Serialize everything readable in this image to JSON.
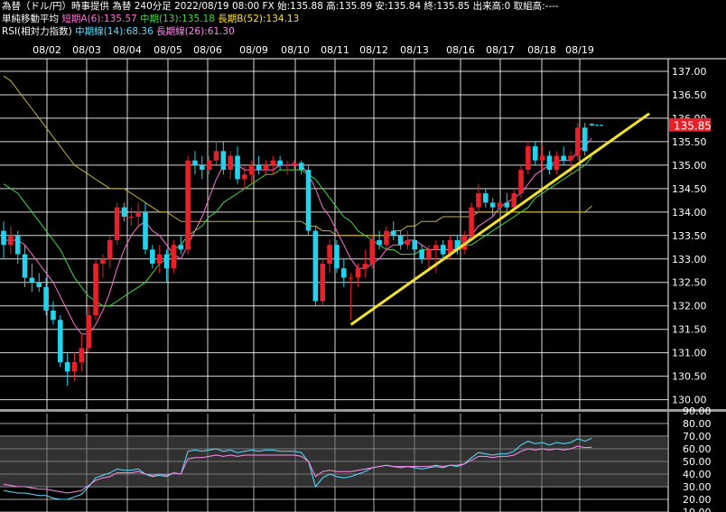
{
  "header": {
    "line1": "為替（ドル/円）時事提供 為替 240分足 2022/08/19 08:00 FX 始:135.88 高:135.89 安:135.84 終:135.85 出来高:0 取組高:----",
    "ma_title": "単純移動平均",
    "ma_short": "短期A(6):135.57",
    "ma_mid": "中期(13):135.18",
    "ma_long": "長期B(52):134.13",
    "rsi_title": "RSI(相対力指数)",
    "rsi_mid": "中期線(14):68.36",
    "rsi_long": "長期線(26):61.30"
  },
  "colors": {
    "background": "#000000",
    "grid": "#ffffff",
    "up_candle": "#e8202a",
    "down_candle": "#22d3ee",
    "ma_short": "#ff6fd8",
    "ma_mid": "#3ddc3d",
    "ma_long": "#c8b040",
    "trendline": "#f0e030",
    "rsi_mid": "#58e0ff",
    "rsi_long": "#ff8cf0",
    "price_tag": "#e8202a",
    "rsi_band": "#5a5a5a"
  },
  "chart_data": [
    {
      "type": "candlestick",
      "timeframe": "240min",
      "categories": [
        "08/02",
        "08/03",
        "08/04",
        "08/05",
        "08/06",
        "08/09",
        "08/10",
        "08/11",
        "08/12",
        "08/13",
        "08/16",
        "08/17",
        "08/18",
        "08/19"
      ],
      "ylim": [
        129.8,
        137.25
      ],
      "yticks": [
        130.0,
        130.5,
        131.0,
        131.5,
        132.0,
        132.5,
        133.0,
        133.5,
        134.0,
        134.5,
        135.0,
        135.5,
        136.0,
        136.5,
        137.0
      ],
      "last_price": "135.85",
      "candles": [
        {
          "o": 133.6,
          "h": 133.8,
          "l": 133.0,
          "c": 133.3
        },
        {
          "o": 133.3,
          "h": 133.7,
          "l": 133.1,
          "c": 133.5
        },
        {
          "o": 133.5,
          "h": 133.6,
          "l": 132.9,
          "c": 133.1
        },
        {
          "o": 133.1,
          "h": 133.3,
          "l": 132.4,
          "c": 132.6
        },
        {
          "o": 132.6,
          "h": 132.9,
          "l": 132.3,
          "c": 132.5
        },
        {
          "o": 132.5,
          "h": 132.7,
          "l": 132.3,
          "c": 132.4
        },
        {
          "o": 132.4,
          "h": 132.6,
          "l": 131.8,
          "c": 131.9
        },
        {
          "o": 131.9,
          "h": 132.1,
          "l": 131.6,
          "c": 131.7
        },
        {
          "o": 131.7,
          "h": 131.8,
          "l": 130.7,
          "c": 130.8
        },
        {
          "o": 130.8,
          "h": 131.0,
          "l": 130.3,
          "c": 130.6
        },
        {
          "o": 130.6,
          "h": 131.0,
          "l": 130.4,
          "c": 130.8
        },
        {
          "o": 130.8,
          "h": 131.4,
          "l": 130.6,
          "c": 131.1
        },
        {
          "o": 131.1,
          "h": 132.0,
          "l": 131.0,
          "c": 131.8
        },
        {
          "o": 131.8,
          "h": 133.0,
          "l": 131.7,
          "c": 132.9
        },
        {
          "o": 132.9,
          "h": 133.1,
          "l": 132.6,
          "c": 133.0
        },
        {
          "o": 133.0,
          "h": 133.5,
          "l": 132.8,
          "c": 133.4
        },
        {
          "o": 133.4,
          "h": 134.2,
          "l": 133.3,
          "c": 134.1
        },
        {
          "o": 134.1,
          "h": 134.2,
          "l": 133.8,
          "c": 133.9
        },
        {
          "o": 133.9,
          "h": 134.1,
          "l": 133.7,
          "c": 133.9
        },
        {
          "o": 133.9,
          "h": 134.2,
          "l": 133.7,
          "c": 134.0
        },
        {
          "o": 134.0,
          "h": 134.2,
          "l": 133.1,
          "c": 133.2
        },
        {
          "o": 133.2,
          "h": 133.3,
          "l": 132.8,
          "c": 132.9
        },
        {
          "o": 132.9,
          "h": 133.3,
          "l": 132.7,
          "c": 133.1
        },
        {
          "o": 133.1,
          "h": 133.2,
          "l": 132.5,
          "c": 132.8
        },
        {
          "o": 132.8,
          "h": 133.4,
          "l": 132.7,
          "c": 133.3
        },
        {
          "o": 133.3,
          "h": 133.5,
          "l": 133.1,
          "c": 133.2
        },
        {
          "o": 133.2,
          "h": 135.2,
          "l": 133.1,
          "c": 135.1
        },
        {
          "o": 135.1,
          "h": 135.3,
          "l": 134.8,
          "c": 135.0
        },
        {
          "o": 135.0,
          "h": 135.2,
          "l": 134.7,
          "c": 134.9
        },
        {
          "o": 134.9,
          "h": 135.2,
          "l": 134.8,
          "c": 135.1
        },
        {
          "o": 135.1,
          "h": 135.5,
          "l": 135.0,
          "c": 135.3
        },
        {
          "o": 135.3,
          "h": 135.5,
          "l": 134.8,
          "c": 134.9
        },
        {
          "o": 134.9,
          "h": 135.3,
          "l": 134.7,
          "c": 135.2
        },
        {
          "o": 135.2,
          "h": 135.4,
          "l": 134.6,
          "c": 134.7
        },
        {
          "o": 134.7,
          "h": 135.0,
          "l": 134.5,
          "c": 134.8
        },
        {
          "o": 134.8,
          "h": 135.1,
          "l": 134.6,
          "c": 135.0
        },
        {
          "o": 135.0,
          "h": 135.2,
          "l": 134.8,
          "c": 134.9
        },
        {
          "o": 134.9,
          "h": 135.1,
          "l": 134.8,
          "c": 135.0
        },
        {
          "o": 135.0,
          "h": 135.2,
          "l": 134.8,
          "c": 135.1
        },
        {
          "o": 135.1,
          "h": 135.2,
          "l": 134.9,
          "c": 135.0
        },
        {
          "o": 135.0,
          "h": 135.1,
          "l": 134.8,
          "c": 135.0
        },
        {
          "o": 135.0,
          "h": 135.1,
          "l": 134.9,
          "c": 135.05
        },
        {
          "o": 135.05,
          "h": 135.1,
          "l": 134.8,
          "c": 134.9
        },
        {
          "o": 134.9,
          "h": 135.0,
          "l": 133.5,
          "c": 133.6
        },
        {
          "o": 133.6,
          "h": 133.7,
          "l": 132.0,
          "c": 132.1
        },
        {
          "o": 132.1,
          "h": 133.0,
          "l": 132.0,
          "c": 132.9
        },
        {
          "o": 132.9,
          "h": 133.4,
          "l": 132.7,
          "c": 133.3
        },
        {
          "o": 133.3,
          "h": 133.4,
          "l": 132.7,
          "c": 132.8
        },
        {
          "o": 132.8,
          "h": 133.0,
          "l": 132.4,
          "c": 132.6
        },
        {
          "o": 132.6,
          "h": 132.7,
          "l": 131.7,
          "c": 132.6
        },
        {
          "o": 132.6,
          "h": 132.9,
          "l": 132.4,
          "c": 132.8
        },
        {
          "o": 132.8,
          "h": 133.2,
          "l": 132.6,
          "c": 132.9
        },
        {
          "o": 132.9,
          "h": 133.5,
          "l": 132.8,
          "c": 133.4
        },
        {
          "o": 133.4,
          "h": 133.6,
          "l": 133.2,
          "c": 133.3
        },
        {
          "o": 133.3,
          "h": 133.7,
          "l": 133.2,
          "c": 133.6
        },
        {
          "o": 133.6,
          "h": 133.8,
          "l": 133.4,
          "c": 133.5
        },
        {
          "o": 133.5,
          "h": 133.6,
          "l": 133.2,
          "c": 133.3
        },
        {
          "o": 133.3,
          "h": 133.6,
          "l": 133.2,
          "c": 133.4
        },
        {
          "o": 133.4,
          "h": 133.5,
          "l": 133.1,
          "c": 133.2
        },
        {
          "o": 133.2,
          "h": 133.3,
          "l": 132.9,
          "c": 133.0
        },
        {
          "o": 133.0,
          "h": 133.3,
          "l": 132.8,
          "c": 133.2
        },
        {
          "o": 133.2,
          "h": 133.4,
          "l": 132.7,
          "c": 133.3
        },
        {
          "o": 133.3,
          "h": 133.4,
          "l": 133.0,
          "c": 133.1
        },
        {
          "o": 133.1,
          "h": 133.5,
          "l": 133.0,
          "c": 133.4
        },
        {
          "o": 133.4,
          "h": 133.5,
          "l": 133.1,
          "c": 133.2
        },
        {
          "o": 133.2,
          "h": 133.6,
          "l": 133.1,
          "c": 133.5
        },
        {
          "o": 133.5,
          "h": 134.2,
          "l": 133.4,
          "c": 134.1
        },
        {
          "o": 134.1,
          "h": 134.6,
          "l": 134.0,
          "c": 134.4
        },
        {
          "o": 134.4,
          "h": 134.5,
          "l": 134.1,
          "c": 134.2
        },
        {
          "o": 134.2,
          "h": 134.3,
          "l": 133.9,
          "c": 134.1
        },
        {
          "o": 134.1,
          "h": 134.3,
          "l": 133.9,
          "c": 134.2
        },
        {
          "o": 134.2,
          "h": 134.4,
          "l": 134.0,
          "c": 134.1
        },
        {
          "o": 134.1,
          "h": 134.5,
          "l": 134.0,
          "c": 134.4
        },
        {
          "o": 134.4,
          "h": 135.0,
          "l": 134.3,
          "c": 134.9
        },
        {
          "o": 134.9,
          "h": 135.5,
          "l": 134.8,
          "c": 135.4
        },
        {
          "o": 135.4,
          "h": 135.5,
          "l": 135.0,
          "c": 135.1
        },
        {
          "o": 135.1,
          "h": 135.4,
          "l": 134.9,
          "c": 135.2
        },
        {
          "o": 135.2,
          "h": 135.3,
          "l": 134.8,
          "c": 134.9
        },
        {
          "o": 134.9,
          "h": 135.3,
          "l": 134.8,
          "c": 135.2
        },
        {
          "o": 135.2,
          "h": 135.4,
          "l": 135.0,
          "c": 135.1
        },
        {
          "o": 135.1,
          "h": 135.3,
          "l": 134.8,
          "c": 135.2
        },
        {
          "o": 135.2,
          "h": 135.9,
          "l": 135.1,
          "c": 135.8
        },
        {
          "o": 135.8,
          "h": 135.9,
          "l": 135.2,
          "c": 135.3
        },
        {
          "o": 135.88,
          "h": 135.89,
          "l": 135.84,
          "c": 135.85
        }
      ],
      "ma_short": [
        133.4,
        133.4,
        133.4,
        133.3,
        133.1,
        132.9,
        132.7,
        132.5,
        132.2,
        131.9,
        131.6,
        131.4,
        131.4,
        131.6,
        131.9,
        132.3,
        132.8,
        133.2,
        133.5,
        133.7,
        133.8,
        133.6,
        133.5,
        133.3,
        133.1,
        133.0,
        133.3,
        133.6,
        133.9,
        134.3,
        134.7,
        135.0,
        135.0,
        135.0,
        134.9,
        134.9,
        134.9,
        134.9,
        134.9,
        135.0,
        135.0,
        135.0,
        135.0,
        134.8,
        134.5,
        134.1,
        133.9,
        133.6,
        133.3,
        133.0,
        132.8,
        132.8,
        132.9,
        133.0,
        133.2,
        133.3,
        133.3,
        133.4,
        133.4,
        133.3,
        133.2,
        133.2,
        133.2,
        133.2,
        133.2,
        133.3,
        133.5,
        133.7,
        133.8,
        133.9,
        134.1,
        134.2,
        134.3,
        134.4,
        134.6,
        134.8,
        134.9,
        135.0,
        135.1,
        135.1,
        135.1,
        135.3,
        135.4,
        135.57
      ],
      "ma_mid": [
        134.6,
        134.5,
        134.4,
        134.2,
        134.0,
        133.8,
        133.6,
        133.4,
        133.2,
        132.9,
        132.6,
        132.4,
        132.2,
        132.1,
        132.0,
        132.0,
        132.1,
        132.2,
        132.3,
        132.4,
        132.5,
        132.7,
        132.9,
        133.0,
        133.2,
        133.3,
        133.5,
        133.6,
        133.7,
        133.9,
        134.0,
        134.2,
        134.3,
        134.4,
        134.5,
        134.6,
        134.7,
        134.8,
        134.8,
        134.9,
        134.9,
        134.9,
        134.9,
        134.8,
        134.7,
        134.5,
        134.3,
        134.1,
        133.9,
        133.8,
        133.6,
        133.5,
        133.4,
        133.3,
        133.2,
        133.2,
        133.1,
        133.1,
        133.1,
        133.2,
        133.2,
        133.2,
        133.2,
        133.2,
        133.2,
        133.3,
        133.3,
        133.4,
        133.5,
        133.6,
        133.7,
        133.8,
        133.9,
        134.0,
        134.1,
        134.3,
        134.4,
        134.5,
        134.6,
        134.7,
        134.8,
        134.9,
        135.0,
        135.18
      ],
      "ma_long": [
        136.9,
        136.8,
        136.6,
        136.4,
        136.2,
        136.0,
        135.8,
        135.6,
        135.4,
        135.2,
        135.0,
        134.9,
        134.8,
        134.7,
        134.6,
        134.5,
        134.5,
        134.5,
        134.4,
        134.3,
        134.2,
        134.1,
        134.0,
        134.0,
        133.9,
        133.8,
        133.8,
        133.8,
        133.8,
        133.8,
        133.8,
        133.8,
        133.8,
        133.8,
        133.8,
        133.8,
        133.8,
        133.8,
        133.8,
        133.8,
        133.8,
        133.8,
        133.8,
        133.7,
        133.7,
        133.6,
        133.6,
        133.5,
        133.5,
        133.5,
        133.5,
        133.5,
        133.5,
        133.5,
        133.5,
        133.6,
        133.6,
        133.7,
        133.7,
        133.8,
        133.8,
        133.8,
        133.9,
        133.9,
        133.9,
        133.9,
        133.9,
        134.0,
        134.0,
        134.0,
        134.0,
        134.0,
        134.0,
        134.0,
        134.0,
        134.0,
        134.0,
        134.0,
        134.0,
        134.0,
        134.0,
        134.0,
        134.0,
        134.13
      ],
      "trendline": {
        "from": {
          "index": 49,
          "price": 131.6
        },
        "to": {
          "index": 86,
          "price": 135.6
        }
      }
    },
    {
      "type": "line",
      "name": "RSI",
      "ylim": [
        10,
        90
      ],
      "yticks": [
        10,
        20,
        30,
        40,
        50,
        60,
        70,
        80,
        90
      ],
      "shaded_band": [
        30,
        70
      ],
      "series": [
        {
          "name": "中期線(14)",
          "color": "#58e0ff",
          "values": [
            27,
            26,
            25,
            25,
            24,
            23,
            23,
            21,
            20,
            20,
            22,
            24,
            30,
            37,
            39,
            41,
            44,
            43,
            43,
            44,
            40,
            38,
            39,
            38,
            41,
            40,
            58,
            59,
            58,
            59,
            60,
            58,
            59,
            57,
            58,
            59,
            58,
            59,
            59,
            58,
            58,
            58,
            57,
            50,
            30,
            37,
            40,
            38,
            37,
            38,
            40,
            42,
            45,
            46,
            47,
            46,
            45,
            46,
            45,
            44,
            45,
            46,
            45,
            47,
            46,
            48,
            53,
            57,
            56,
            55,
            56,
            56,
            58,
            63,
            66,
            64,
            65,
            63,
            65,
            64,
            65,
            68,
            66,
            68.36
          ]
        },
        {
          "name": "長期線(26)",
          "color": "#ff8cf0",
          "values": [
            32,
            31,
            30,
            30,
            29,
            28,
            28,
            27,
            26,
            25,
            26,
            27,
            31,
            35,
            37,
            38,
            41,
            41,
            41,
            42,
            40,
            39,
            40,
            39,
            41,
            40,
            52,
            53,
            53,
            54,
            55,
            54,
            55,
            54,
            55,
            55,
            55,
            55,
            55,
            55,
            55,
            55,
            54,
            50,
            38,
            42,
            43,
            42,
            42,
            42,
            43,
            44,
            45,
            46,
            47,
            46,
            46,
            46,
            46,
            46,
            46,
            47,
            46,
            47,
            47,
            48,
            51,
            54,
            54,
            53,
            54,
            54,
            55,
            58,
            60,
            59,
            60,
            59,
            60,
            59,
            60,
            62,
            61,
            61.3
          ]
        }
      ]
    }
  ]
}
